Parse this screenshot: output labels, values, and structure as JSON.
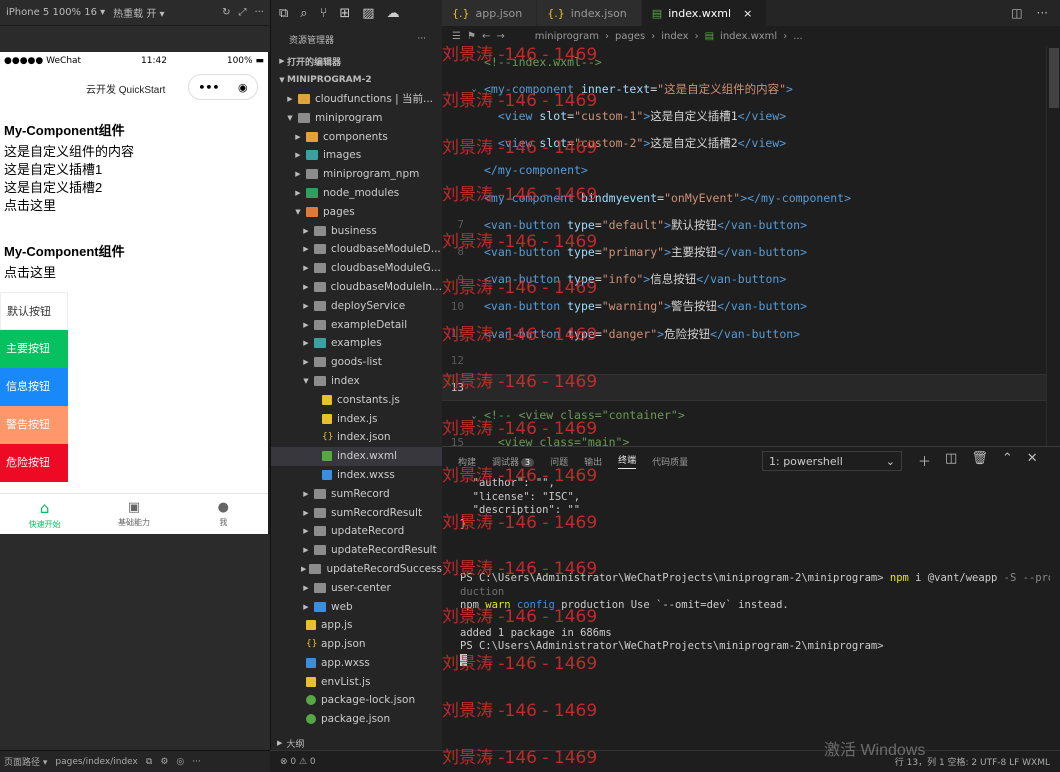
{
  "simulator": {
    "device": "iPhone 5 100% 16 ▾",
    "hot_reload": "热重载 开 ▾",
    "status_carrier": "●●●●● WeChat",
    "status_time": "11:42",
    "status_battery": "100%",
    "nav_title": "云开发 QuickStart",
    "heading1": "My-Component组件",
    "lines1": [
      "这是自定义组件的内容",
      "这是自定义插槽1",
      "这是自定义插槽2",
      "点击这里"
    ],
    "heading2": "My-Component组件",
    "line2": "点击这里",
    "buttons": [
      "默认按钮",
      "主要按钮",
      "信息按钮",
      "警告按钮",
      "危险按钮"
    ],
    "tabbar": [
      "快速开始",
      "基础能力",
      "我"
    ],
    "footer_path_label": "页面路径 ▾",
    "footer_path": "pages/index/index"
  },
  "explorer": {
    "title": "资源管理器",
    "more": "···",
    "open_editors": "打开的编辑器",
    "project": "MINIPROGRAM-2",
    "outline": "大纲",
    "items": [
      {
        "label": "cloudfunctions | 当前...",
        "depth": 1,
        "kind": "folder-cloud",
        "arrow": "▶"
      },
      {
        "label": "miniprogram",
        "depth": 1,
        "kind": "folder",
        "arrow": "▼"
      },
      {
        "label": "components",
        "depth": 2,
        "kind": "folder-cloud",
        "arrow": "▶"
      },
      {
        "label": "images",
        "depth": 2,
        "kind": "folder-teal",
        "arrow": "▶"
      },
      {
        "label": "miniprogram_npm",
        "depth": 2,
        "kind": "folder",
        "arrow": "▶"
      },
      {
        "label": "node_modules",
        "depth": 2,
        "kind": "folder-green",
        "arrow": "▶"
      },
      {
        "label": "pages",
        "depth": 2,
        "kind": "folder-orange",
        "arrow": "▼"
      },
      {
        "label": "business",
        "depth": 3,
        "kind": "folder",
        "arrow": "▶"
      },
      {
        "label": "cloudbaseModuleD...",
        "depth": 3,
        "kind": "folder",
        "arrow": "▶"
      },
      {
        "label": "cloudbaseModuleG...",
        "depth": 3,
        "kind": "folder",
        "arrow": "▶"
      },
      {
        "label": "cloudbaseModuleIn...",
        "depth": 3,
        "kind": "folder",
        "arrow": "▶"
      },
      {
        "label": "deployService",
        "depth": 3,
        "kind": "folder",
        "arrow": "▶"
      },
      {
        "label": "exampleDetail",
        "depth": 3,
        "kind": "folder",
        "arrow": "▶"
      },
      {
        "label": "examples",
        "depth": 3,
        "kind": "folder-teal",
        "arrow": "▶"
      },
      {
        "label": "goods-list",
        "depth": 3,
        "kind": "folder",
        "arrow": "▶"
      },
      {
        "label": "index",
        "depth": 3,
        "kind": "folder",
        "arrow": "▼"
      },
      {
        "label": "constants.js",
        "depth": 4,
        "kind": "file-js",
        "arrow": ""
      },
      {
        "label": "index.js",
        "depth": 4,
        "kind": "file-js",
        "arrow": ""
      },
      {
        "label": "index.json",
        "depth": 4,
        "kind": "file-json",
        "arrow": ""
      },
      {
        "label": "index.wxml",
        "depth": 4,
        "kind": "file-wxml",
        "arrow": "",
        "selected": true
      },
      {
        "label": "index.wxss",
        "depth": 4,
        "kind": "file-wxss",
        "arrow": ""
      },
      {
        "label": "sumRecord",
        "depth": 3,
        "kind": "folder",
        "arrow": "▶"
      },
      {
        "label": "sumRecordResult",
        "depth": 3,
        "kind": "folder",
        "arrow": "▶"
      },
      {
        "label": "updateRecord",
        "depth": 3,
        "kind": "folder",
        "arrow": "▶"
      },
      {
        "label": "updateRecordResult",
        "depth": 3,
        "kind": "folder",
        "arrow": "▶"
      },
      {
        "label": "updateRecordSuccess",
        "depth": 3,
        "kind": "folder",
        "arrow": "▶"
      },
      {
        "label": "user-center",
        "depth": 3,
        "kind": "folder",
        "arrow": "▶"
      },
      {
        "label": "web",
        "depth": 3,
        "kind": "folder-blue",
        "arrow": "▶"
      },
      {
        "label": "app.js",
        "depth": 2,
        "kind": "file-js",
        "arrow": ""
      },
      {
        "label": "app.json",
        "depth": 2,
        "kind": "file-json",
        "arrow": ""
      },
      {
        "label": "app.wxss",
        "depth": 2,
        "kind": "file-wxss",
        "arrow": ""
      },
      {
        "label": "envList.js",
        "depth": 2,
        "kind": "file-js",
        "arrow": ""
      },
      {
        "label": "package-lock.json",
        "depth": 2,
        "kind": "file-pkg",
        "arrow": ""
      },
      {
        "label": "package.json",
        "depth": 2,
        "kind": "file-pkg",
        "arrow": ""
      }
    ]
  },
  "editor": {
    "tabs": [
      {
        "label": "app.json",
        "icon": "{.}",
        "active": false
      },
      {
        "label": "index.json",
        "icon": "{.}",
        "active": false
      },
      {
        "label": "index.wxml",
        "icon": "▤",
        "active": true
      }
    ],
    "breadcrumb": [
      "miniprogram",
      "pages",
      "index",
      "index.wxml",
      "..."
    ],
    "lines": [
      {
        "n": "",
        "fold": "",
        "html": "<span class=\"t-cm\">&lt;!--index.wxml--&gt;</span>"
      },
      {
        "n": "",
        "fold": "⌄",
        "html": "<span class=\"t-tag\">&lt;my-component</span> <span class=\"t-attr\">inner-text</span>=<span class=\"t-str\">\"这是自定义组件的内容\"</span><span class=\"t-tag\">&gt;</span>"
      },
      {
        "n": "",
        "fold": "",
        "html": "  <span class=\"t-tag\">&lt;view</span> <span class=\"t-attr\">slot</span>=<span class=\"t-str\">\"custom-1\"</span><span class=\"t-tag\">&gt;</span><span class=\"t-txt\">这是自定义插槽1</span><span class=\"t-tag\">&lt;/view&gt;</span>"
      },
      {
        "n": "",
        "fold": "",
        "html": "  <span class=\"t-tag\">&lt;view</span> <span class=\"t-attr\">slot</span>=<span class=\"t-str\">\"custom-2\"</span><span class=\"t-tag\">&gt;</span><span class=\"t-txt\">这是自定义插槽2</span><span class=\"t-tag\">&lt;/view&gt;</span>"
      },
      {
        "n": "",
        "fold": "",
        "html": "<span class=\"t-tag\">&lt;/my-component&gt;</span>"
      },
      {
        "n": "",
        "fold": "",
        "html": "<span class=\"t-tag\">&lt;my-component</span> <span class=\"t-attr\">bindmyevent</span>=<span class=\"t-str\">\"onMyEvent\"</span><span class=\"t-tag\">&gt;&lt;/my-component&gt;</span>"
      },
      {
        "n": "7",
        "fold": "",
        "html": "<span class=\"t-tag\">&lt;van-button</span> <span class=\"t-attr\">type</span>=<span class=\"t-str\">\"default\"</span><span class=\"t-tag\">&gt;</span><span class=\"t-txt\">默认按钮</span><span class=\"t-tag\">&lt;/van-button&gt;</span>"
      },
      {
        "n": "8",
        "fold": "",
        "html": "<span class=\"t-tag\">&lt;van-button</span> <span class=\"t-attr\">type</span>=<span class=\"t-str\">\"primary\"</span><span class=\"t-tag\">&gt;</span><span class=\"t-txt\">主要按钮</span><span class=\"t-tag\">&lt;/van-button&gt;</span>"
      },
      {
        "n": "9",
        "fold": "",
        "html": "<span class=\"t-tag\">&lt;van-button</span> <span class=\"t-attr\">type</span>=<span class=\"t-str\">\"info\"</span><span class=\"t-tag\">&gt;</span><span class=\"t-txt\">信息按钮</span><span class=\"t-tag\">&lt;/van-button&gt;</span>"
      },
      {
        "n": "10",
        "fold": "",
        "html": "<span class=\"t-tag\">&lt;van-button</span> <span class=\"t-attr\">type</span>=<span class=\"t-str\">\"warning\"</span><span class=\"t-tag\">&gt;</span><span class=\"t-txt\">警告按钮</span><span class=\"t-tag\">&lt;/van-button&gt;</span>"
      },
      {
        "n": "11",
        "fold": "",
        "html": "<span class=\"t-tag\">&lt;van-button</span> <span class=\"t-attr\">type</span>=<span class=\"t-str\">\"danger\"</span><span class=\"t-tag\">&gt;</span><span class=\"t-txt\">危险按钮</span><span class=\"t-tag\">&lt;/van-button&gt;</span>"
      },
      {
        "n": "12",
        "fold": "",
        "html": ""
      },
      {
        "n": "13",
        "fold": "",
        "html": "",
        "current": true
      },
      {
        "n": "",
        "fold": "⌄",
        "html": "<span class=\"t-cm\">&lt;!-- &lt;view class=\"container\"&gt;</span>"
      },
      {
        "n": "15",
        "fold": "",
        "html": "  <span class=\"t-cm\">&lt;view class=\"main\"&gt;</span>"
      }
    ]
  },
  "panel": {
    "tabs": [
      {
        "label": "构建",
        "active": false
      },
      {
        "label": "调试器",
        "active": false,
        "badge": "3"
      },
      {
        "label": "问题",
        "active": false
      },
      {
        "label": "输出",
        "active": false
      },
      {
        "label": "终端",
        "active": true
      },
      {
        "label": "代码质量",
        "active": false
      }
    ],
    "terminal_select": "1: powershell",
    "terminal_lines": [
      {
        "t": "  \"author\": \"\",",
        "cls": ""
      },
      {
        "t": "  \"license\": \"ISC\",",
        "cls": ""
      },
      {
        "t": "  \"description\": \"\"",
        "cls": ""
      },
      {
        "t": "}",
        "cls": ""
      },
      {
        "t": "",
        "cls": ""
      },
      {
        "t": "",
        "cls": ""
      },
      {
        "t": "",
        "cls": ""
      },
      {
        "t": "PS C:\\Users\\Administrator\\WeChatProjects\\miniprogram-2\\miniprogram> <span class=\"t-yellow\">npm</span> i @vant/weapp <span class=\"t-gray\">-S --pro</span>",
        "cls": ""
      },
      {
        "t": "duction",
        "cls": "dim"
      },
      {
        "t": "npm <span class=\"t-yellow\">warn</span> <span class=\"t-blue\">config</span> production Use `--omit=dev` instead.",
        "cls": ""
      },
      {
        "t": "",
        "cls": ""
      },
      {
        "t": "added 1 package in 686ms",
        "cls": ""
      },
      {
        "t": "PS C:\\Users\\Administrator\\WeChatProjects\\miniprogram-2\\miniprogram>",
        "cls": ""
      },
      {
        "t": "<span class=\"cursor\"></span>",
        "cls": ""
      }
    ]
  },
  "status_bar": {
    "problems": "⊗ 0 ⚠ 0",
    "position": "行 13，列 1  空格: 2  UTF-8  LF  WXML"
  },
  "watermark": {
    "text": "刘景涛 -146 - 1469",
    "activate": "激活 Windows"
  }
}
